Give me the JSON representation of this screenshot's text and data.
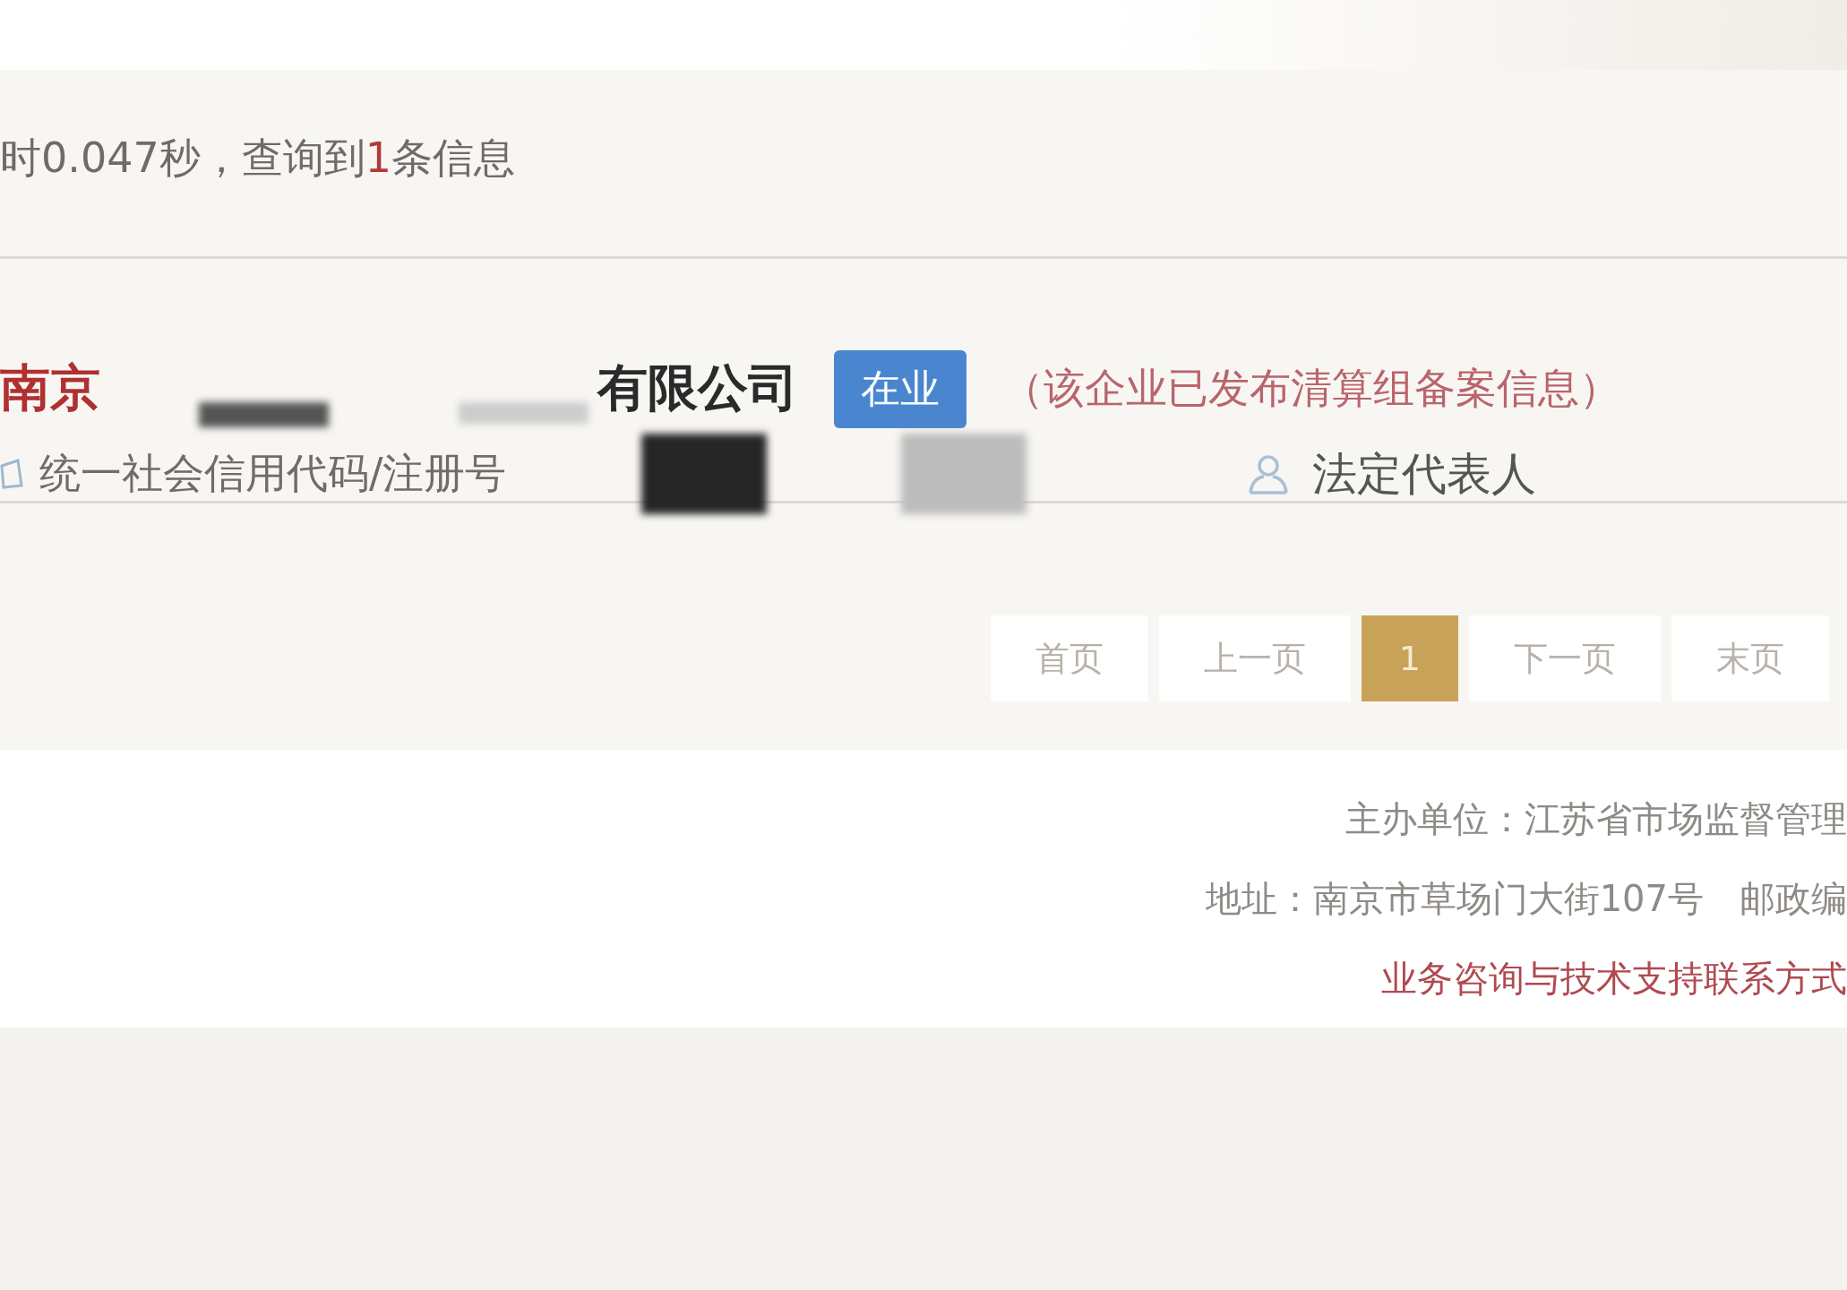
{
  "summary": {
    "prefix": "时0.047秒，查询到",
    "count": "1",
    "suffix": "条信息"
  },
  "result": {
    "name_start": "南京",
    "name_end": "有限公司",
    "status": "在业",
    "note": "（该企业已发布清算组备案信息）",
    "code_label": "统一社会信用代码/注册号",
    "rep_label": "法定代表人"
  },
  "pagination": [
    {
      "label": "首页",
      "selected": false
    },
    {
      "label": "上一页",
      "selected": false
    },
    {
      "label": "1",
      "selected": true
    },
    {
      "label": "下一页",
      "selected": false
    },
    {
      "label": "末页",
      "selected": false
    }
  ],
  "footer": [
    {
      "text": "主办单位：江苏省市场监督管理",
      "kind": "plain"
    },
    {
      "text": "地址：南京市草场门大街107号　邮政编",
      "kind": "plain"
    },
    {
      "text": "业务咨询与技术支持联系方式",
      "kind": "link"
    }
  ]
}
